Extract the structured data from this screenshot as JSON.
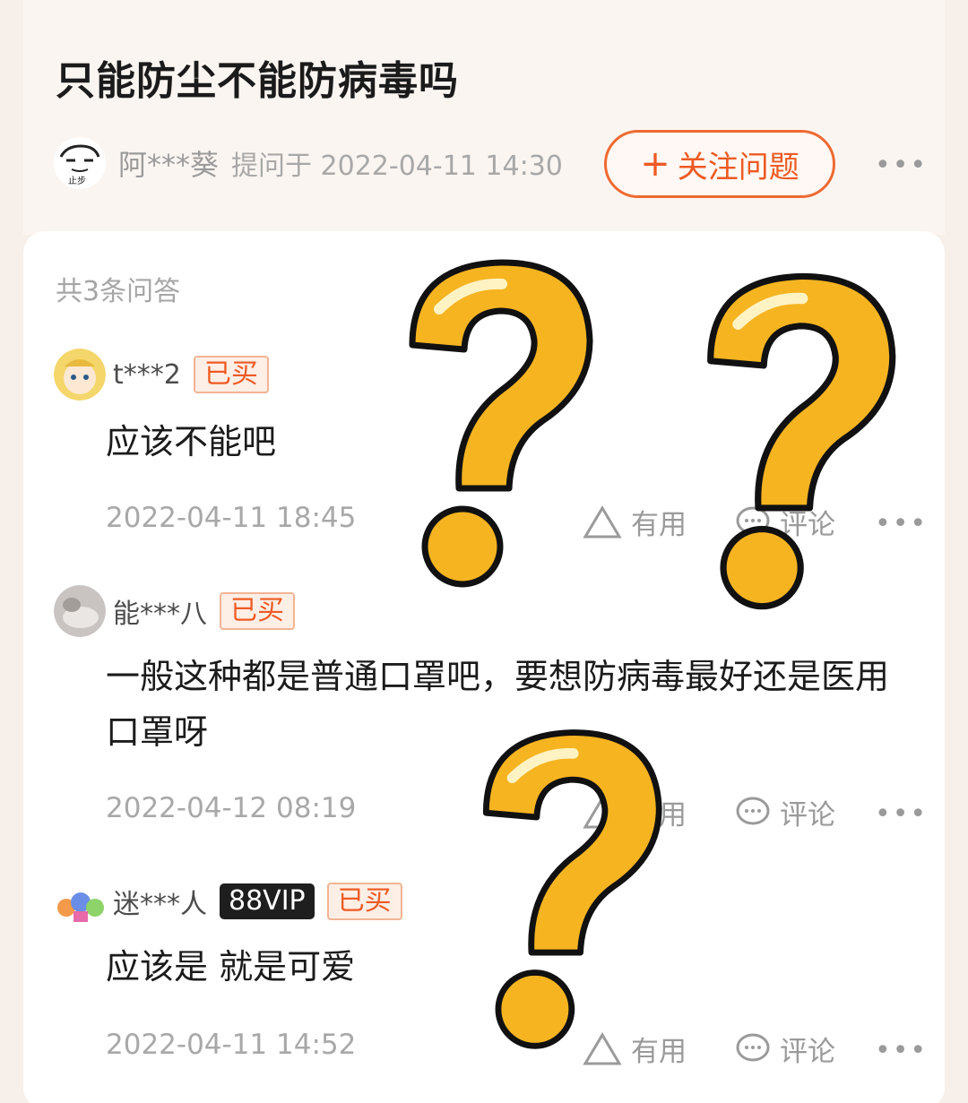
{
  "question": {
    "title": "只能防尘不能防病毒吗",
    "asker_name": "阿***葵",
    "asker_meta": "提问于 2022-04-11 14:30",
    "follow_label": "关注问题",
    "more": "•••"
  },
  "answers_count": "共3条问答",
  "answers": [
    {
      "user": "t***2",
      "badges": [
        "已买"
      ],
      "text": "应该不能吧",
      "time": "2022-04-11 18:45",
      "useful_label": "有用",
      "comment_label": "评论"
    },
    {
      "user": "能***八",
      "badges": [
        "已买"
      ],
      "text": "一般这种都是普通口罩吧，要想防病毒最好还是医用口罩呀",
      "time": "2022-04-12 08:19",
      "useful_label": "有用",
      "comment_label": "评论"
    },
    {
      "user": "迷***人",
      "vip": "88VIP",
      "badges": [
        "已买"
      ],
      "text": "应该是  就是可爱",
      "time": "2022-04-11 14:52",
      "useful_label": "有用",
      "comment_label": "评论"
    }
  ],
  "colors": {
    "accent": "#ee5a22",
    "question_mark": "#f7b731"
  }
}
